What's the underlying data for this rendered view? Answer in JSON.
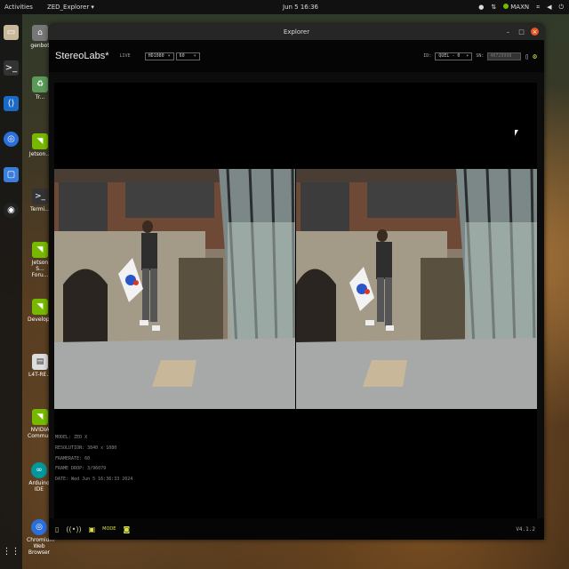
{
  "system_bar": {
    "activities": "Activities",
    "app_menu": "ZED_Explorer ▾",
    "clock": "Jun 5  16:36",
    "tray_label": "MAXN",
    "tray_icons": [
      "chrome-icon",
      "ethernet-icon",
      "nvidia-icon",
      "network-icon",
      "volume-icon",
      "power-icon"
    ]
  },
  "dock": {
    "icons": [
      "files-icon",
      "terminal-icon",
      "vscode-icon",
      "chromium-icon",
      "screenshot-icon",
      "obs-icon",
      "app-grid-icon"
    ]
  },
  "desktop": {
    "icons": [
      {
        "label": "genbot",
        "icon": "home-folder-icon"
      },
      {
        "label": "Tr...",
        "icon": "trash-icon"
      },
      {
        "label": "Jetson...",
        "icon": "nvidia-icon"
      },
      {
        "label": "Termi...",
        "icon": "terminal-icon"
      },
      {
        "label": "Jetson S... Foru...",
        "icon": "nvidia-icon"
      },
      {
        "label": "Develop...",
        "icon": "nvidia-icon"
      },
      {
        "label": "L4T-RE...",
        "icon": "document-icon"
      },
      {
        "label": "NVIDIA Communi...",
        "icon": "nvidia-icon"
      },
      {
        "label": "Arduino IDE",
        "icon": "arduino-icon"
      },
      {
        "label": "Chromium Web Browser",
        "icon": "chromium-icon"
      }
    ]
  },
  "window": {
    "title": "Explorer",
    "controls": {
      "minimize": "–",
      "maximize": "□",
      "close": "×"
    }
  },
  "toolbar": {
    "brand": "StereoLabs*",
    "status": "LIVE",
    "resolution_value": "HD1080",
    "fps_value": "60",
    "id_label": "ID:",
    "id_value": "QUEL - 0",
    "sn_label": "SN:",
    "sn_value": "40729998",
    "icons": [
      "record-icon",
      "settings-icon"
    ]
  },
  "info": {
    "model": "MODEL: ZED X",
    "resolution": "RESOLUTION: 3840 x 1080",
    "framerate": "FRAMERATE: 60",
    "frame_drop": "FRAME DROP: 3/96079",
    "date": "DATE: Wed Jun 5 16:36:33 2024"
  },
  "bottombar": {
    "icons": [
      "file-icon",
      "wireless-icon",
      "sensor-icon",
      "mode-icon",
      "camera-icon"
    ],
    "mode_label": "MODE",
    "version": "V4.1.2"
  },
  "colors": {
    "accent_close": "#e95420",
    "nvidia_green": "#76b900"
  }
}
